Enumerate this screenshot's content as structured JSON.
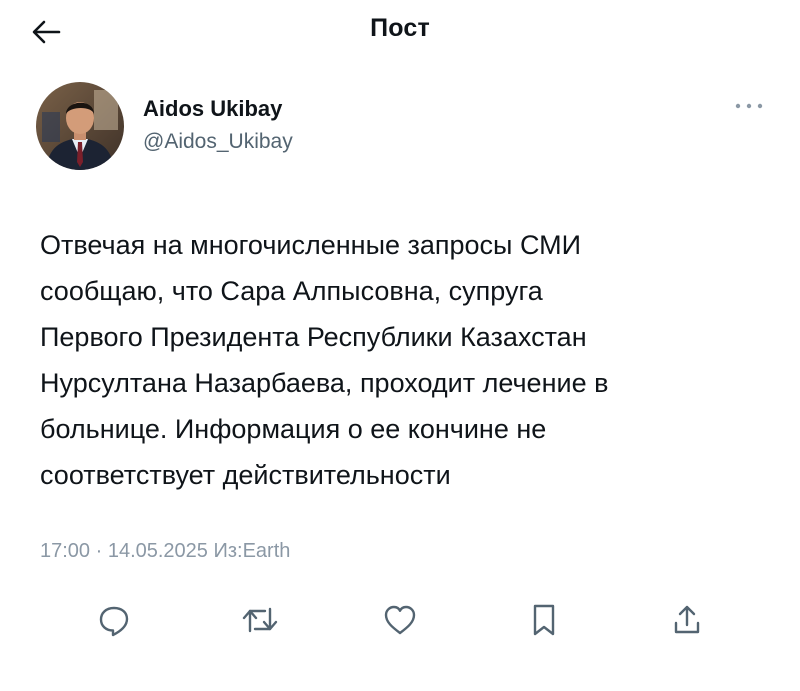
{
  "header": {
    "title": "Пост",
    "back_icon": "arrow-left-icon"
  },
  "author": {
    "display_name": "Aidos Ukibay",
    "handle": "@Aidos_Ukibay",
    "more_icon": "more-dots-icon"
  },
  "tweet": {
    "text": "Отвечая на многочисленные запросы СМИ\nсообщаю, что Сара Алпысовна, супруга\nПервого Президента Республики Казахстан\nНурсултана Назарбаева, проходит лечение в\nбольнице. Информация о ее кончине не\nсоответствует действительности",
    "meta": "17:00 · 14.05.2025 Из:Earth"
  },
  "actions": [
    {
      "name": "reply",
      "icon": "reply-icon"
    },
    {
      "name": "retweet",
      "icon": "retweet-icon"
    },
    {
      "name": "like",
      "icon": "heart-icon"
    },
    {
      "name": "bookmark",
      "icon": "bookmark-icon"
    },
    {
      "name": "share",
      "icon": "share-icon"
    }
  ],
  "colors": {
    "text": "#0f1419",
    "secondary": "#536471",
    "meta": "#8b98a5",
    "icon": "#536471"
  }
}
